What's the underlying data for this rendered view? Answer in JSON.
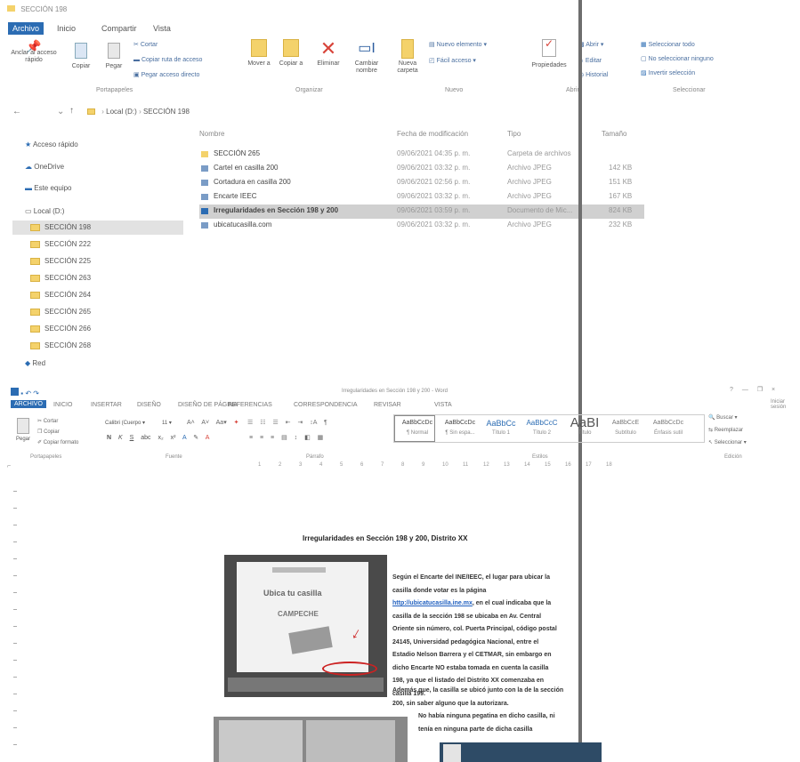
{
  "explorer": {
    "title": "SECCIÓN 198",
    "tabs": [
      "Archivo",
      "Inicio",
      "Compartir",
      "Vista"
    ],
    "ribbon": {
      "pin_label": "Anclar al acceso rápido",
      "copy_label": "Copiar",
      "paste_label": "Pegar",
      "cut_label": "Cortar",
      "copy_path_label": "Copiar ruta de acceso",
      "paste_shortcut_label": "Pegar acceso directo",
      "move_label": "Mover a",
      "copyto_label": "Copiar a",
      "delete_label": "Eliminar",
      "rename_label": "Cambiar nombre",
      "newfolder_label": "Nueva carpeta",
      "newitem_label": "Nuevo elemento",
      "easyaccess_label": "Fácil acceso",
      "properties_label": "Propiedades",
      "open_label": "Abrir",
      "edit_label": "Editar",
      "history_label": "Historial",
      "selectall_label": "Seleccionar todo",
      "selectnone_label": "No seleccionar ninguno",
      "invert_label": "Invertir selección",
      "groups": [
        "Portapapeles",
        "Organizar",
        "Nuevo",
        "Abrir",
        "Seleccionar"
      ]
    },
    "breadcrumb": [
      "Local (D:)",
      "SECCIÓN 198"
    ],
    "columns": [
      "Nombre",
      "Fecha de modificación",
      "Tipo",
      "Tamaño"
    ],
    "files": [
      {
        "name": "SECCIÓN 265",
        "date": "09/06/2021 04:35 p. m.",
        "type": "Carpeta de archivos",
        "size": ""
      },
      {
        "name": "Cartel en casilla 200",
        "date": "09/06/2021 03:32 p. m.",
        "type": "Archivo JPEG",
        "size": "142 KB"
      },
      {
        "name": "Cortadura en casilla 200",
        "date": "09/06/2021 02:56 p. m.",
        "type": "Archivo JPEG",
        "size": "151 KB"
      },
      {
        "name": "Encarte IEEC",
        "date": "09/06/2021 03:32 p. m.",
        "type": "Archivo JPEG",
        "size": "167 KB"
      },
      {
        "name": "Irregularidades en Sección 198 y 200",
        "date": "09/06/2021 03:59 p. m.",
        "type": "Documento de Mic...",
        "size": "824 KB"
      },
      {
        "name": "ubicatucasilla.com",
        "date": "09/06/2021 03:32 p. m.",
        "type": "Archivo JPEG",
        "size": "232 KB"
      }
    ],
    "nav": {
      "quick_access": "Acceso rápido",
      "onedrive": "OneDrive",
      "this_pc": "Este equipo",
      "local_drive": "Local (D:)",
      "folders": [
        "SECCIÓN 198",
        "SECCIÓN 222",
        "SECCIÓN 225",
        "SECCIÓN 263",
        "SECCIÓN 264",
        "SECCIÓN 265",
        "SECCIÓN 266",
        "SECCIÓN 268"
      ],
      "network": "Red"
    }
  },
  "word": {
    "title": "Irregularidades en Sección 198 y 200 - Word",
    "tabs": [
      "ARCHIVO",
      "INICIO",
      "INSERTAR",
      "DISEÑO",
      "DISEÑO DE PÁGINA",
      "REFERENCIAS",
      "CORRESPONDENCIA",
      "REVISAR",
      "VISTA"
    ],
    "clipboard": {
      "paste": "Pegar",
      "cut": "Cortar",
      "copy": "Copiar",
      "painter": "Copiar formato"
    },
    "font_name": "Calibri (Cuerpo",
    "font_size": "11",
    "styles": [
      {
        "preview": "AaBbCcDc",
        "label": "¶ Normal"
      },
      {
        "preview": "AaBbCcDc",
        "label": "¶ Sin espa..."
      },
      {
        "preview": "AaBbCc",
        "label": "Título 1"
      },
      {
        "preview": "AaBbCcC",
        "label": "Título 2"
      },
      {
        "preview": "AaBI",
        "label": "Título"
      },
      {
        "preview": "AaBbCcE",
        "label": "Subtítulo"
      },
      {
        "preview": "AaBbCcDc",
        "label": "Énfasis sutil"
      }
    ],
    "editing": {
      "find": "Buscar",
      "replace": "Reemplazar",
      "select": "Seleccionar"
    },
    "groups": [
      "Portapapeles",
      "Fuente",
      "Párrafo",
      "Estilos",
      "Edición"
    ],
    "window_controls": [
      "?",
      "—",
      "❐",
      "×"
    ],
    "sign_in": "Iniciar sesión",
    "ruler_marks": [
      "1",
      "2",
      "3",
      "4",
      "5",
      "6",
      "7",
      "8",
      "9",
      "10",
      "11",
      "12",
      "13",
      "14",
      "15",
      "16",
      "17",
      "18"
    ],
    "doc": {
      "heading": "Irregularidades en Sección 198 y 200, Distrito XX",
      "para1_lines": [
        "Según el Encarte del INE/IEEC, el lugar para ubicar la",
        "casilla donde votar es la página",
        "http://ubicatucasilla.ine.mx, en el cual indicaba que la",
        "casilla de la sección 198 se ubicaba en Av. Central",
        "Oriente sin número, col. Puerta Principal, código postal",
        "24145, Universidad pedagógica Nacional, entre el",
        "Estadio Nelson Barrera y el CETMAR, sin embargo en",
        "dicho Encarte NO estaba tomada en cuenta la casilla",
        "198, ya que el listado del Distrito XX comenzaba en",
        "casilla 199."
      ],
      "para2_lines": [
        "Además que, la casilla se ubicó junto con la de la sección",
        "200, sin saber alguno que la autorizara."
      ],
      "para3_lines": [
        "No había ninguna pegatina en dicho casilla, ni",
        "tenía en ninguna parte de dicha casilla"
      ],
      "link": "http://ubicatucasilla.ine.mx",
      "photo_flyer_line1": "Ubica tu casilla",
      "photo_flyer_line2": "CAMPECHE"
    }
  },
  "colors": {
    "accent": "#2b6cb3",
    "folder": "#f4d26b",
    "selection": "#d0d0d0",
    "delete_red": "#d8443a"
  }
}
